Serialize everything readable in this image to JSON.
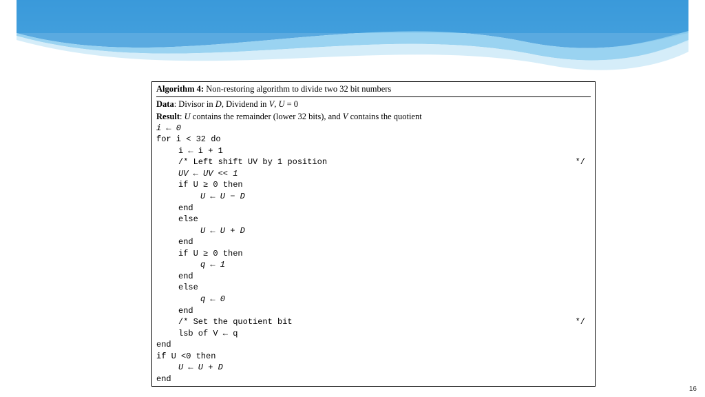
{
  "banner": {
    "top_color": "#2a8fd6",
    "mid_color": "#6cb9e6",
    "light_color": "#cfe9f7"
  },
  "algo": {
    "title_bold": "Algorithm 4:",
    "title_rest": " Non-restoring algorithm to divide two 32 bit numbers",
    "data_label": "Data",
    "data_text_1": ": Divisor in ",
    "data_D": "D",
    "data_text_2": ", Dividend in ",
    "data_V": "V",
    "data_text_3": ", ",
    "data_U": "U",
    "data_text_4": " = 0",
    "result_label": "Result",
    "result_text_1": ": ",
    "result_U": "U",
    "result_text_2": " contains the remainder (lower 32 bits), and ",
    "result_V": "V",
    "result_text_3": " contains the quotient",
    "l_init": "i ← 0",
    "l_for": "for i < 32 do",
    "l_inc": "i ← i + 1",
    "l_c1_left": "/* Left shift UV by 1 position",
    "l_c1_right": "*/",
    "l_shift": "UV ← UV << 1",
    "l_if1": "if U ≥ 0 then",
    "l_sub": "U ← U − D",
    "l_end1": "end",
    "l_else1": "else",
    "l_add": "U ← U + D",
    "l_end2": "end",
    "l_if2": "if U ≥ 0 then",
    "l_q1": "q ← 1",
    "l_end3": "end",
    "l_else2": "else",
    "l_q0": "q ← 0",
    "l_end4": "end",
    "l_c2_left": "/* Set the quotient bit",
    "l_c2_right": "*/",
    "l_lsb": "lsb of V ← q",
    "l_endfor": "end",
    "l_if3": "if U <0 then",
    "l_add2": "U ← U + D",
    "l_endif3": "end"
  },
  "page_number": "16"
}
